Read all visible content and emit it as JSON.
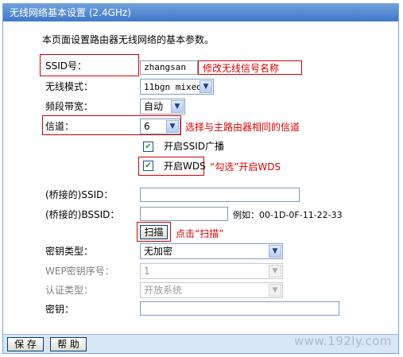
{
  "window": {
    "title": "无线网络基本设置 (2.4GHz)"
  },
  "intro": "本页面设置路由器无线网络的基本参数。",
  "fields": {
    "ssid": {
      "label": "SSID号：",
      "value": "zhangsan"
    },
    "mode": {
      "label": "无线模式：",
      "value": "11bgn mixed"
    },
    "bandwidth": {
      "label": "频段带宽：",
      "value": "自动"
    },
    "channel": {
      "label": "信道：",
      "value": "6"
    },
    "enable_ssid_broadcast": {
      "label": "开启SSID广播",
      "checked": true
    },
    "enable_wds": {
      "label": "开启WDS",
      "checked": true
    },
    "bridge_ssid": {
      "label": "(桥接的)SSID：",
      "value": ""
    },
    "bridge_bssid": {
      "label": "(桥接的)BSSID：",
      "value": "",
      "example": "例如：00-1D-0F-11-22-33"
    },
    "scan_button": "扫描",
    "key_type": {
      "label": "密钥类型：",
      "value": "无加密"
    },
    "wep_index": {
      "label": "WEP密钥序号：",
      "value": "1"
    },
    "auth_type": {
      "label": "认证类型：",
      "value": "开放系统"
    },
    "key": {
      "label": "密钥：",
      "value": ""
    }
  },
  "annotations": {
    "ssid_note": "修改无线信号名称",
    "channel_note": "选择与主路由器相同的信道",
    "wds_note": "“勾选”开启WDS",
    "scan_note": "点击“扫描”",
    "color": "#d40000"
  },
  "footer": {
    "save": "保 存",
    "help": "帮 助"
  },
  "watermark": "www.192ly.com"
}
